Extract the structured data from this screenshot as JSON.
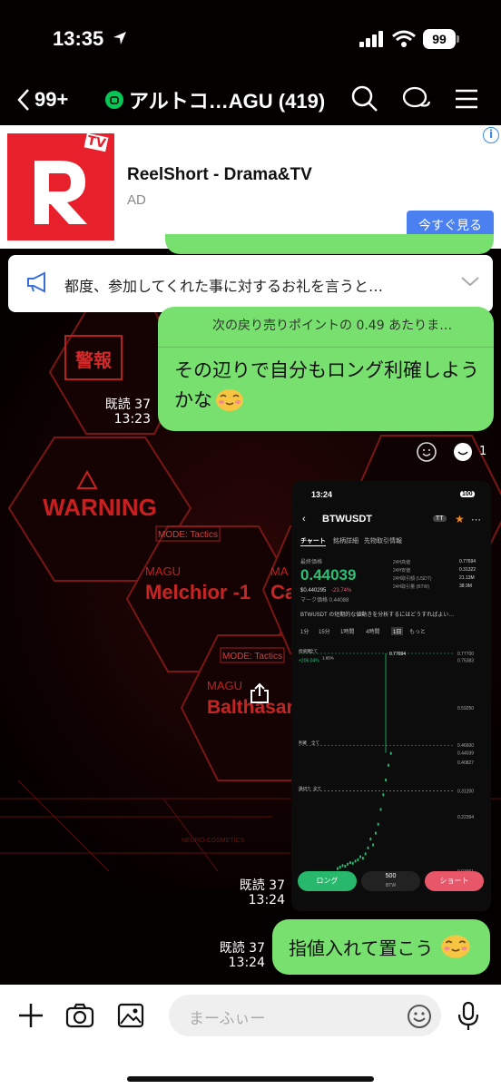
{
  "status": {
    "time": "13:35",
    "battery": "99"
  },
  "header": {
    "back_count": "99+",
    "title": "アルトコ…AGU (419)"
  },
  "ad": {
    "title": "ReelShort - Drama&TV",
    "label": "AD",
    "cta": "今すぐ見る",
    "logo_badge": "TV",
    "info": "i"
  },
  "announcement": {
    "text": "都度、参加してくれた事に対するお礼を言うと…"
  },
  "messages": [
    {
      "quote": "次の戻り売りポイントの 0.49 あたりま…",
      "text": "その辺りで自分もロング利確しようかな",
      "read": "既読 37",
      "time": "13:23"
    },
    {
      "type": "image",
      "read": "既読 37",
      "time": "13:24",
      "reaction_count": "1"
    },
    {
      "text": "指値入れて置こう",
      "read": "既読 37",
      "time": "13:24"
    }
  ],
  "background_art": {
    "warning_label": "WARNING",
    "keihou": "警報",
    "mode1": "MODE: Tactics",
    "mode2": "MODE: Tactics",
    "magu1": "MAGU",
    "melchior": "Melchior -1",
    "magu2": "MAGU",
    "balthasar": "Balthasar",
    "magu3": "MA",
    "ca": "Ca",
    "footer": "NEURO-COSMETICS"
  },
  "screenshot": {
    "time": "13:24",
    "battery": "100",
    "pair": "BTWUSDT",
    "tab_active": "チャート",
    "tab2": "銘柄詳細",
    "tab3": "先物取引情報",
    "last_label": "最終価格",
    "price": "0.44039",
    "sub_price": "$0.440295",
    "change": "-23.74%",
    "mark": "マーク価格 0.44088",
    "stats": [
      {
        "label": "24H高値",
        "value": "0.77694"
      },
      {
        "label": "24H安値",
        "value": "0.31322"
      },
      {
        "label": "24H取引額 (USDT)",
        "value": "21.13M"
      },
      {
        "label": "24H取引量 (BTW)",
        "value": "38.9M"
      }
    ],
    "news": "BTWUSDT の短期的な値動きを分析するにはどうすればよい…",
    "intervals": [
      "1分",
      "15分",
      "1時間",
      "4時間",
      "1日",
      "もっと"
    ],
    "peak_label": "0.77694",
    "low_label": "0.03961",
    "pct_label": "+206.04%",
    "axis": [
      "0.77700",
      "0.75383",
      "0.59250",
      "0.46600",
      "0.44039",
      "0.40827",
      "0.31200",
      "0.22394",
      "0.03961"
    ],
    "tags": [
      "指値買",
      "全て",
      "1.65%",
      "利確",
      "全て",
      "損切り",
      "全て"
    ],
    "long": "ロング",
    "qty": "500",
    "qty_unit": "BTW",
    "short": "ショート",
    "tt_badge": "TT"
  },
  "footer": {
    "placeholder": "まーふぃー"
  },
  "colors": {
    "bubble": "#78e06e",
    "line_green": "#06c755",
    "ad_cta": "#4a80f0",
    "logo_red": "#e8202c"
  }
}
